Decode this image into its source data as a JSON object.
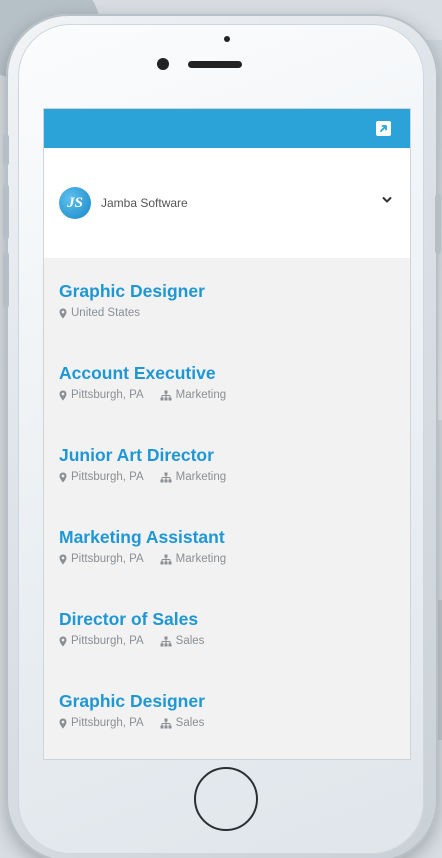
{
  "company": {
    "name": "Jamba Software",
    "logo_text": "JS"
  },
  "jobs": [
    {
      "title": "Graphic Designer",
      "location": "United States",
      "department": ""
    },
    {
      "title": "Account Executive",
      "location": "Pittsburgh, PA",
      "department": "Marketing"
    },
    {
      "title": "Junior Art Director",
      "location": "Pittsburgh, PA",
      "department": "Marketing"
    },
    {
      "title": "Marketing Assistant",
      "location": "Pittsburgh, PA",
      "department": "Marketing"
    },
    {
      "title": "Director of Sales",
      "location": "Pittsburgh, PA",
      "department": "Sales"
    },
    {
      "title": "Graphic Designer",
      "location": "Pittsburgh, PA",
      "department": "Sales"
    }
  ],
  "icons": {
    "topbar": "external-link-icon",
    "dropdown": "chevron-down-icon",
    "location": "map-pin-icon",
    "department": "org-chart-icon"
  },
  "colors": {
    "accent": "#2ba3d9",
    "title": "#1f97d4",
    "meta": "#8a8f94",
    "screen_bg": "#f2f2f2"
  }
}
